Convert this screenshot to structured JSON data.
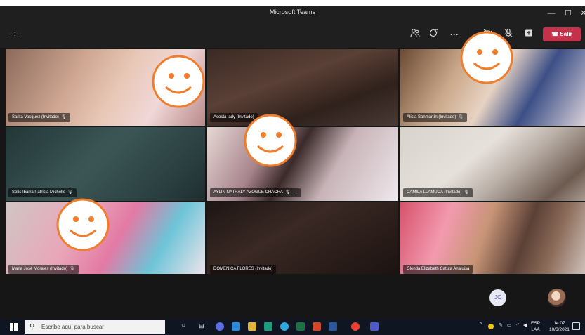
{
  "window": {
    "title": "Microsoft Teams",
    "minimize": "—",
    "maximize": "☐",
    "close": "✕"
  },
  "toolbar": {
    "timer": "--:--",
    "people_icon": "people-icon",
    "chat_icon": "chat-icon",
    "more_label": "···",
    "camera_off_label": "camera-off-icon",
    "mic_off_label": "mic-off-icon",
    "share_label": "share-icon",
    "leave_label": "Salir",
    "leave_color": "#c4314b"
  },
  "participants": [
    {
      "name": "Sarita Vasquez (Invitado)"
    },
    {
      "name": "Acosta lady (Invitado)"
    },
    {
      "name": "Alicia Sanmartín (Invitado)"
    },
    {
      "name": "Solís Ibarra Patricia Michelle"
    },
    {
      "name": "AYLIN NATHALY AZOGUE CHACHA"
    },
    {
      "name": "CAMILA LLAMUCA (Invitado)"
    },
    {
      "name": "Maria José Morales (Invitado)"
    },
    {
      "name": "DOMENICA FLORES (Invitado)"
    },
    {
      "name": "Glenda Elizabeth Catuta Analuisa"
    }
  ],
  "overlay": {
    "avatar_initials": "JC"
  },
  "taskbar": {
    "search_placeholder": "Escribe aquí para buscar",
    "lang_line1": "ESP",
    "lang_line2": "LAA",
    "time": "14:07",
    "date": "10/6/2021"
  }
}
